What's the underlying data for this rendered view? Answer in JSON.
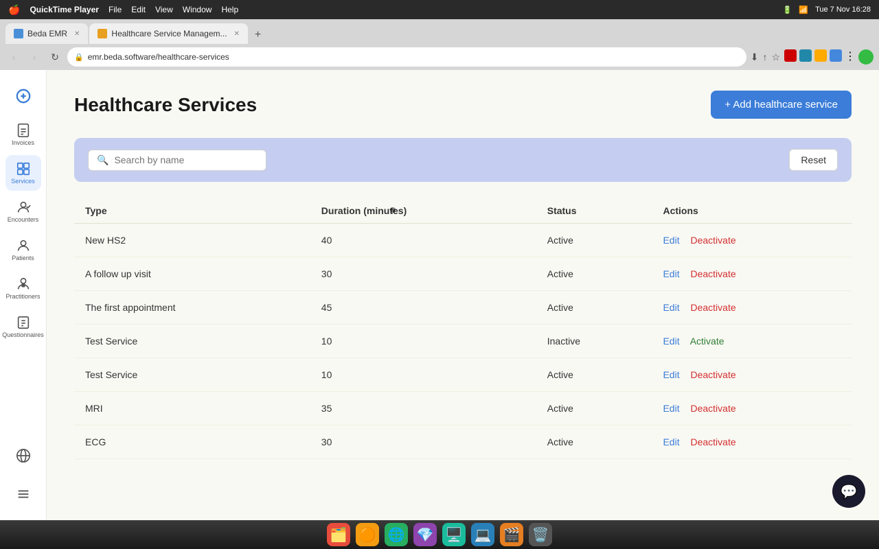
{
  "macbar": {
    "apple": "🍎",
    "app": "QuickTime Player",
    "menus": [
      "File",
      "Edit",
      "View",
      "Window",
      "Help"
    ],
    "time": "Tue 7 Nov  16:28"
  },
  "browser": {
    "tabs": [
      {
        "id": "tab-beda",
        "label": "Beda EMR",
        "favicon_color": "#4a90d9",
        "active": false
      },
      {
        "id": "tab-hs",
        "label": "Healthcare Service Managem...",
        "favicon_color": "#e8a020",
        "active": true
      }
    ],
    "address": "emr.beda.software/healthcare-services"
  },
  "sidebar": {
    "items": [
      {
        "id": "plus",
        "label": "",
        "icon": "plus",
        "active": false
      },
      {
        "id": "invoices",
        "label": "Invoices",
        "icon": "invoice",
        "active": false
      },
      {
        "id": "services",
        "label": "Services",
        "icon": "services",
        "active": true
      },
      {
        "id": "encounters",
        "label": "Encounters",
        "icon": "encounters",
        "active": false
      },
      {
        "id": "patients",
        "label": "Patients",
        "icon": "patients",
        "active": false
      },
      {
        "id": "practitioners",
        "label": "Practitioners",
        "icon": "practitioners",
        "active": false
      },
      {
        "id": "questionnaires",
        "label": "Questionnaires",
        "icon": "questionnaires",
        "active": false
      },
      {
        "id": "globe",
        "label": "",
        "icon": "globe",
        "active": false
      },
      {
        "id": "menu",
        "label": "",
        "icon": "menu",
        "active": false
      }
    ]
  },
  "page": {
    "title": "Healthcare Services",
    "add_button": "+ Add healthcare service"
  },
  "search": {
    "placeholder": "Search by name",
    "value": "",
    "reset_label": "Reset"
  },
  "table": {
    "columns": [
      "Type",
      "Duration (minutes)",
      "Status",
      "Actions"
    ],
    "rows": [
      {
        "id": "row1",
        "type": "New HS2",
        "duration": "40",
        "status": "Active",
        "edit": "Edit",
        "action": "Deactivate",
        "action_type": "deactivate"
      },
      {
        "id": "row2",
        "type": "A follow up visit",
        "duration": "30",
        "status": "Active",
        "edit": "Edit",
        "action": "Deactivate",
        "action_type": "deactivate"
      },
      {
        "id": "row3",
        "type": "The first appointment",
        "duration": "45",
        "status": "Active",
        "edit": "Edit",
        "action": "Deactivate",
        "action_type": "deactivate"
      },
      {
        "id": "row4",
        "type": "Test Service",
        "duration": "10",
        "status": "Inactive",
        "edit": "Edit",
        "action": "Activate",
        "action_type": "activate"
      },
      {
        "id": "row5",
        "type": "Test Service",
        "duration": "10",
        "status": "Active",
        "edit": "Edit",
        "action": "Deactivate",
        "action_type": "deactivate"
      },
      {
        "id": "row6",
        "type": "MRI",
        "duration": "35",
        "status": "Active",
        "edit": "Edit",
        "action": "Deactivate",
        "action_type": "deactivate"
      },
      {
        "id": "row7",
        "type": "ECG",
        "duration": "30",
        "status": "Active",
        "edit": "Edit",
        "action": "Deactivate",
        "action_type": "deactivate"
      }
    ]
  },
  "dock": {
    "items": [
      "🗂️",
      "🟠",
      "🌐",
      "💎",
      "🖥️",
      "💻",
      "🎬",
      "🗑️"
    ]
  }
}
